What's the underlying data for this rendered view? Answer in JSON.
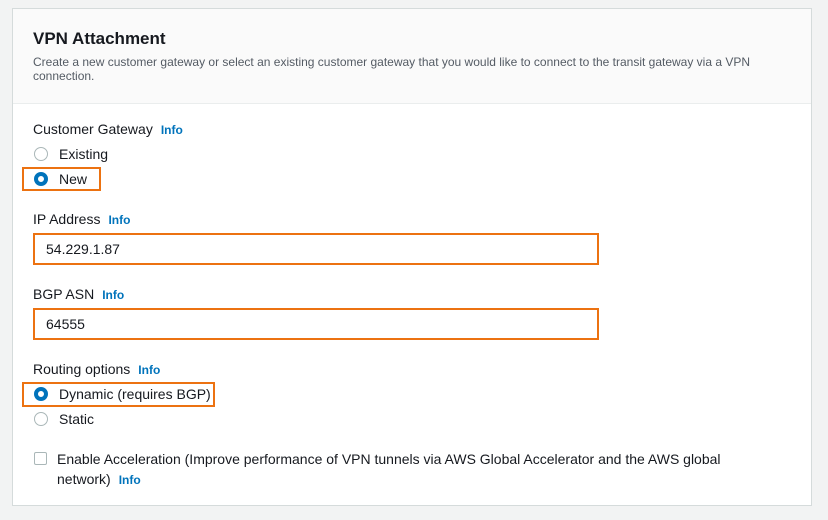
{
  "section": {
    "title": "VPN Attachment",
    "description": "Create a new customer gateway or select an existing customer gateway that you would like to connect to the transit gateway via a VPN connection."
  },
  "customer_gateway": {
    "label": "Customer Gateway",
    "info": "Info",
    "options": [
      "Existing",
      "New"
    ],
    "selected": "New"
  },
  "ip_address": {
    "label": "IP Address",
    "info": "Info",
    "value": "54.229.1.87"
  },
  "bgp_asn": {
    "label": "BGP ASN",
    "info": "Info",
    "value": "64555"
  },
  "routing_options": {
    "label": "Routing options",
    "info": "Info",
    "options": [
      "Dynamic (requires BGP)",
      "Static"
    ],
    "selected": "Dynamic (requires BGP)"
  },
  "acceleration": {
    "label": "Enable Acceleration (Improve performance of VPN tunnels via AWS Global Accelerator and the AWS global network)",
    "info": "Info",
    "checked": false
  },
  "colors": {
    "accent": "#0073bb",
    "highlight": "#ec7211"
  }
}
